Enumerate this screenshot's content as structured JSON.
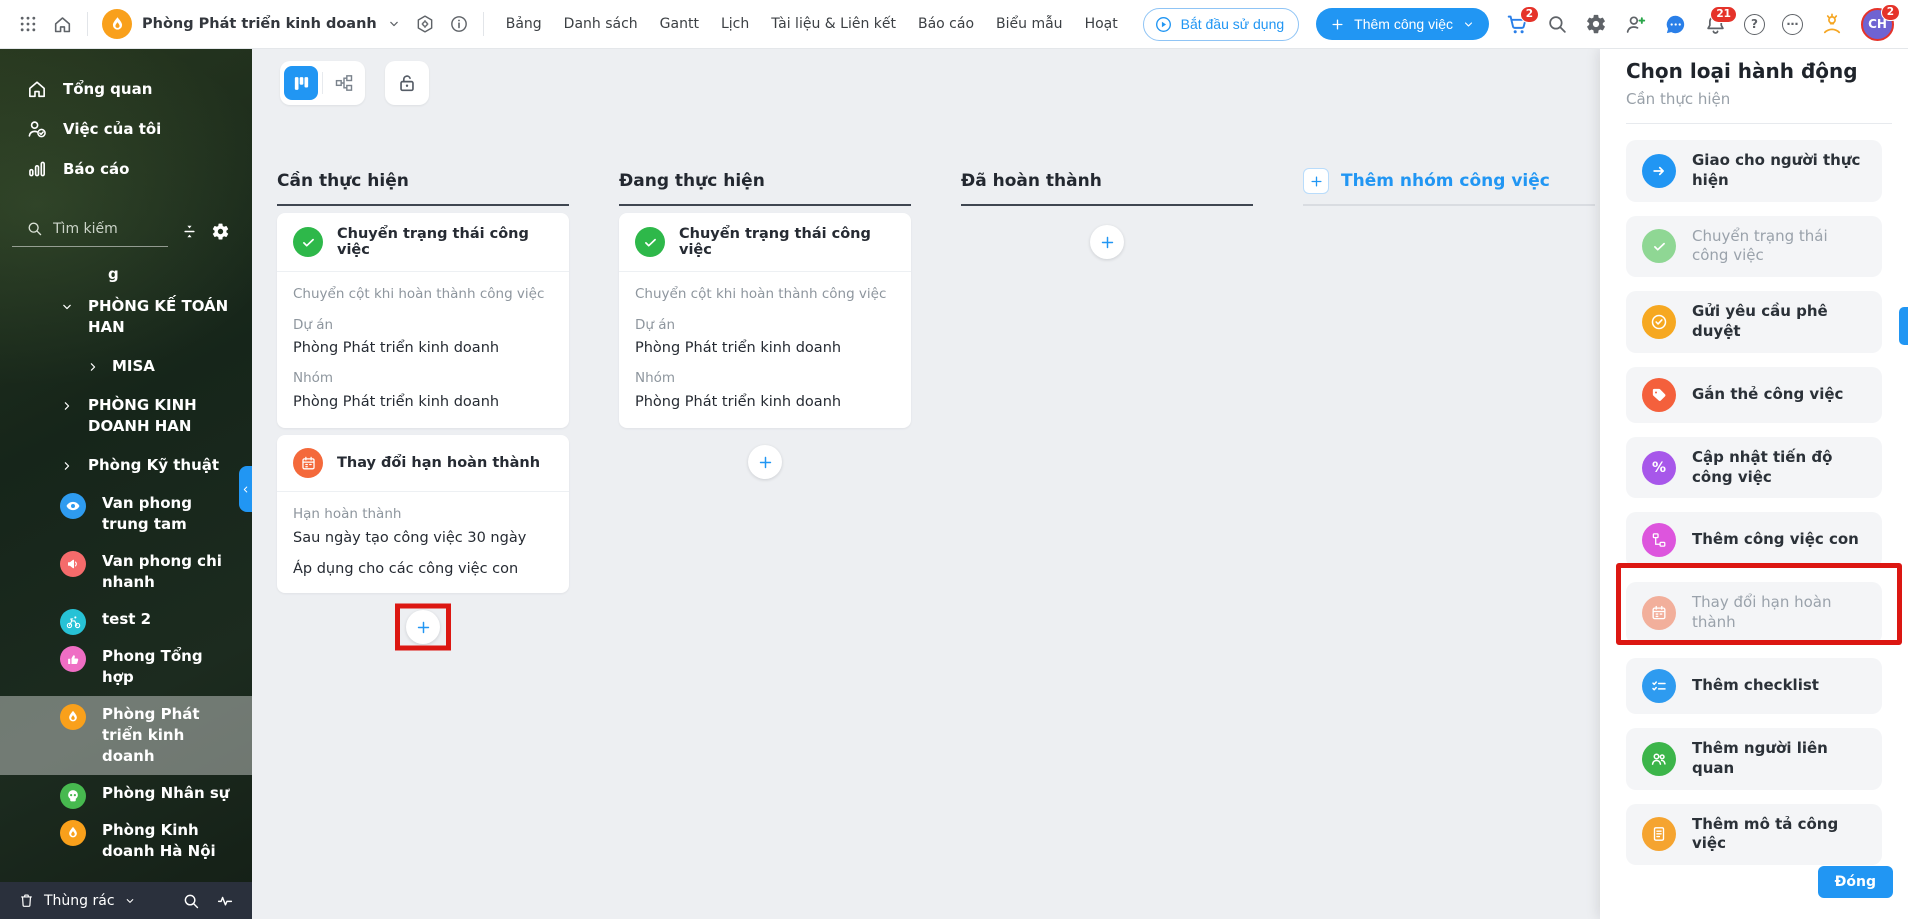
{
  "topbar": {
    "workspace": "Phòng Phát triển kinh doanh",
    "nav": [
      "Bảng",
      "Danh sách",
      "Gantt",
      "Lịch",
      "Tài liệu & Liên kết",
      "Báo cáo",
      "Biểu mẫu",
      "Hoạt"
    ],
    "start_button": "Bắt đầu sử dụng",
    "add_task_button": "Thêm công việc",
    "cart_badge": "2",
    "notification_badge": "21",
    "help_glyph": "?",
    "more_glyph": "⋯",
    "avatar": {
      "initials": "CH",
      "badge": "2"
    }
  },
  "sidebar": {
    "items": [
      {
        "label": "Tổng quan"
      },
      {
        "label": "Việc của tôi"
      },
      {
        "label": "Báo cáo"
      }
    ],
    "search_placeholder": "Tìm kiếm",
    "group_letter": "g",
    "tree": [
      {
        "label": "PHÒNG KẾ TOÁN HAN"
      },
      {
        "label": "MISA"
      },
      {
        "label": "PHÒNG KINH DOANH HAN"
      },
      {
        "label": "Phòng Kỹ thuật"
      },
      {
        "label": "Van phong trung tam",
        "color": "#2e9bf0"
      },
      {
        "label": "Van phong chi nhanh",
        "color": "#f56b6b"
      },
      {
        "label": "test 2",
        "color": "#27c2d6"
      },
      {
        "label": "Phong Tổng hợp",
        "color": "#ef6ec4"
      },
      {
        "label": "Phòng Phát triển kinh doanh",
        "color": "#f9a01b",
        "selected": true
      },
      {
        "label": "Phòng Nhân sự",
        "color": "#47b94f"
      },
      {
        "label": "Phòng Kinh doanh Hà Nội",
        "color": "#f9a01b"
      }
    ],
    "trash_label": "Thùng rác"
  },
  "board": {
    "columns": [
      {
        "title": "Cần thực hiện",
        "cards": [
          {
            "title": "Chuyển trạng thái công việc",
            "icon_color": "#2eb84a",
            "description": "Chuyển cột khi hoàn thành công việc",
            "fields": [
              {
                "label": "Dự án",
                "value": "Phòng Phát triển kinh doanh"
              },
              {
                "label": "Nhóm",
                "value": "Phòng Phát triển kinh doanh"
              }
            ]
          },
          {
            "title": "Thay đổi hạn hoàn thành",
            "icon_color": "#f4693b",
            "fields": [
              {
                "label": "Hạn hoàn thành",
                "value": "Sau ngày tạo công việc 30 ngày"
              }
            ],
            "note": "Áp dụng cho các công việc con"
          }
        ]
      },
      {
        "title": "Đang thực hiện",
        "cards": [
          {
            "title": "Chuyển trạng thái công việc",
            "icon_color": "#2eb84a",
            "description": "Chuyển cột khi hoàn thành công việc",
            "fields": [
              {
                "label": "Dự án",
                "value": "Phòng Phát triển kinh doanh"
              },
              {
                "label": "Nhóm",
                "value": "Phòng Phát triển kinh doanh"
              }
            ]
          }
        ]
      },
      {
        "title": "Đã hoàn thành",
        "cards": []
      }
    ],
    "add_group_label": "Thêm nhóm công việc"
  },
  "panel": {
    "title": "Chọn loại hành động",
    "subtitle": "Cần thực hiện",
    "close_button": "Đóng",
    "actions": [
      {
        "label": "Giao cho người thực hiện",
        "color": "#2196f3"
      },
      {
        "label": "Chuyển trạng thái công việc",
        "color": "#8fd794",
        "disabled": true
      },
      {
        "label": "Gửi yêu cầu phê duyệt",
        "color": "#f6a821"
      },
      {
        "label": "Gắn thẻ công việc",
        "color": "#f4603c"
      },
      {
        "label": "Cập nhật tiến độ công việc",
        "color": "#a757ea",
        "percent_glyph": "%"
      },
      {
        "label": "Thêm công việc con",
        "color": "#dd55dd",
        "annotated": true
      },
      {
        "label": "Thay đổi hạn hoàn thành",
        "color": "#f2af9b",
        "disabled": true
      },
      {
        "label": "Thêm checklist",
        "color": "#2e9bf0"
      },
      {
        "label": "Thêm người liên quan",
        "color": "#3cb54a"
      },
      {
        "label": "Thêm mô tả công việc",
        "color": "#f5a430"
      }
    ]
  },
  "colors": {
    "accent": "#2196f3",
    "annotation": "#dc1712"
  }
}
